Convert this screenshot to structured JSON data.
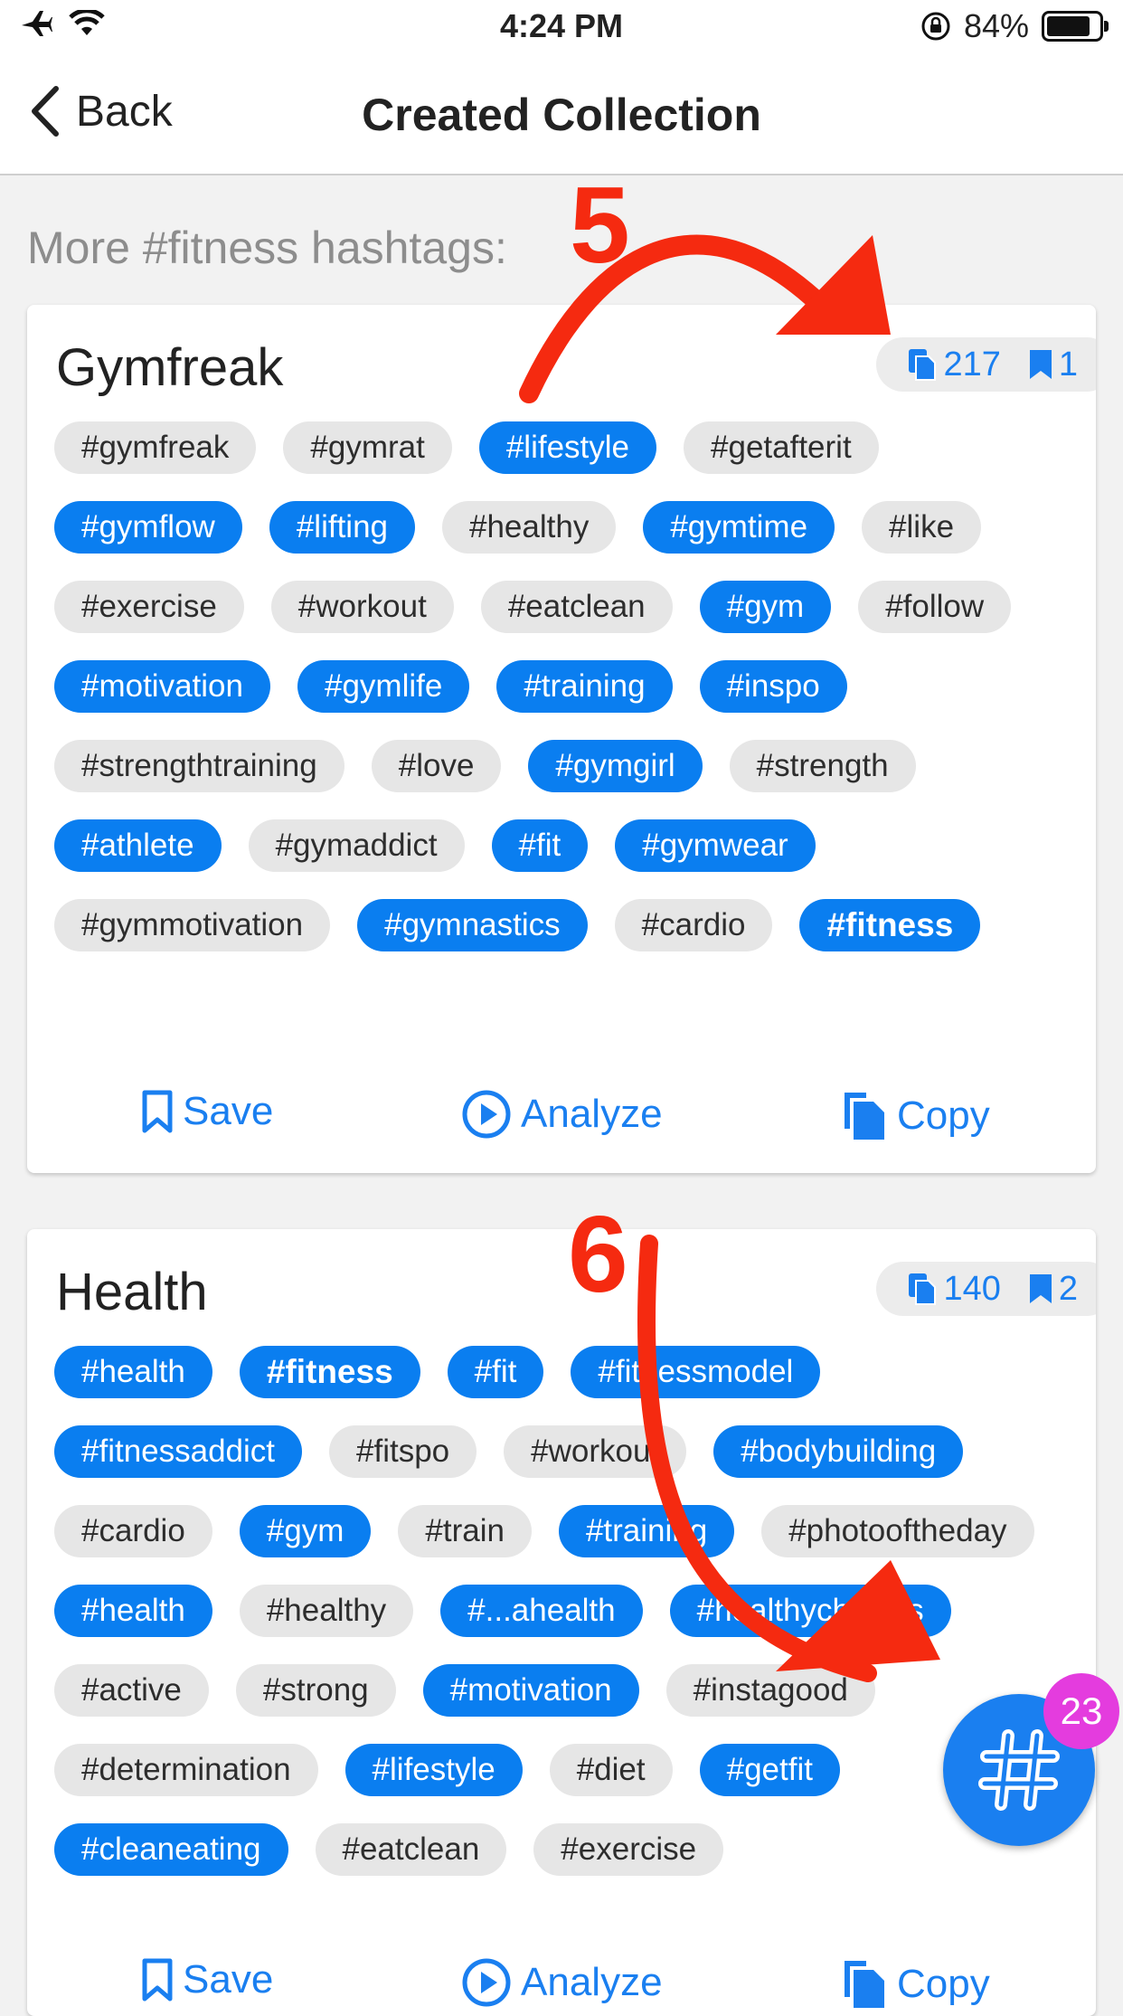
{
  "status_bar": {
    "time": "4:24 PM",
    "battery_percent": "84%",
    "battery_level": 0.84,
    "icons": [
      "airplane-icon",
      "wifi-icon",
      "rotation-lock-icon",
      "battery-icon"
    ]
  },
  "nav": {
    "back_label": "Back",
    "title": "Created Collection"
  },
  "section_heading": "More #fitness hashtags:",
  "collections": [
    {
      "name": "Gymfreak",
      "copies": "217",
      "saves": "1",
      "tags": [
        {
          "text": "#gymfreak",
          "selected": false
        },
        {
          "text": "#gymrat",
          "selected": false
        },
        {
          "text": "#lifestyle",
          "selected": true
        },
        {
          "text": "#getafterit",
          "selected": false
        },
        {
          "text": "#gymflow",
          "selected": true
        },
        {
          "text": "#lifting",
          "selected": true
        },
        {
          "text": "#healthy",
          "selected": false
        },
        {
          "text": "#gymtime",
          "selected": true
        },
        {
          "text": "#like",
          "selected": false
        },
        {
          "text": "#exercise",
          "selected": false
        },
        {
          "text": "#workout",
          "selected": false
        },
        {
          "text": "#eatclean",
          "selected": false
        },
        {
          "text": "#gym",
          "selected": true
        },
        {
          "text": "#follow",
          "selected": false
        },
        {
          "text": "#motivation",
          "selected": true
        },
        {
          "text": "#gymlife",
          "selected": true
        },
        {
          "text": "#training",
          "selected": true
        },
        {
          "text": "#inspo",
          "selected": true
        },
        {
          "text": "#strengthtraining",
          "selected": false
        },
        {
          "text": "#love",
          "selected": false
        },
        {
          "text": "#gymgirl",
          "selected": true
        },
        {
          "text": "#strength",
          "selected": false
        },
        {
          "text": "#athlete",
          "selected": true
        },
        {
          "text": "#gymaddict",
          "selected": false
        },
        {
          "text": "#fit",
          "selected": true
        },
        {
          "text": "#gymwear",
          "selected": true
        },
        {
          "text": "#gymmotivation",
          "selected": false
        },
        {
          "text": "#gymnastics",
          "selected": true
        },
        {
          "text": "#cardio",
          "selected": false
        },
        {
          "text": "#fitness",
          "selected": true,
          "bold": true
        }
      ],
      "actions": {
        "save": "Save",
        "analyze": "Analyze",
        "copy": "Copy"
      }
    },
    {
      "name": "Health",
      "copies": "140",
      "saves": "2",
      "tags": [
        {
          "text": "#health",
          "selected": true
        },
        {
          "text": "#fitness",
          "selected": true,
          "bold": true
        },
        {
          "text": "#fit",
          "selected": true
        },
        {
          "text": "#fitnessmodel",
          "selected": true
        },
        {
          "text": "#fitnessaddict",
          "selected": true
        },
        {
          "text": "#fitspo",
          "selected": false
        },
        {
          "text": "#workout",
          "selected": false
        },
        {
          "text": "#bodybuilding",
          "selected": true
        },
        {
          "text": "#cardio",
          "selected": false
        },
        {
          "text": "#gym",
          "selected": true
        },
        {
          "text": "#train",
          "selected": false
        },
        {
          "text": "#training",
          "selected": true
        },
        {
          "text": "#photooftheday",
          "selected": false
        },
        {
          "text": "#health",
          "selected": true
        },
        {
          "text": "#healthy",
          "selected": false
        },
        {
          "text": "#...ahealth",
          "selected": true
        },
        {
          "text": "#healthychoices",
          "selected": true
        },
        {
          "text": "#active",
          "selected": false
        },
        {
          "text": "#strong",
          "selected": false
        },
        {
          "text": "#motivation",
          "selected": true
        },
        {
          "text": "#instagood",
          "selected": false
        },
        {
          "text": "#determination",
          "selected": false
        },
        {
          "text": "#lifestyle",
          "selected": true
        },
        {
          "text": "#diet",
          "selected": false
        },
        {
          "text": "#getfit",
          "selected": true
        },
        {
          "text": "#cleaneating",
          "selected": true
        },
        {
          "text": "#eatclean",
          "selected": false
        },
        {
          "text": "#exercise",
          "selected": false
        }
      ],
      "actions": {
        "save": "Save",
        "analyze": "Analyze",
        "copy": "Copy"
      }
    }
  ],
  "fab": {
    "icon": "hashtag-icon",
    "badge": "23"
  },
  "annotations": [
    {
      "label": "5",
      "color": "#f52a10"
    },
    {
      "label": "6",
      "color": "#f52a10"
    }
  ],
  "colors": {
    "accent": "#1a7ff0",
    "tag_selected": "#0a7ef0",
    "tag_unselected": "#e6e6e6",
    "badge": "#e43cde",
    "annotation": "#f52a10"
  }
}
